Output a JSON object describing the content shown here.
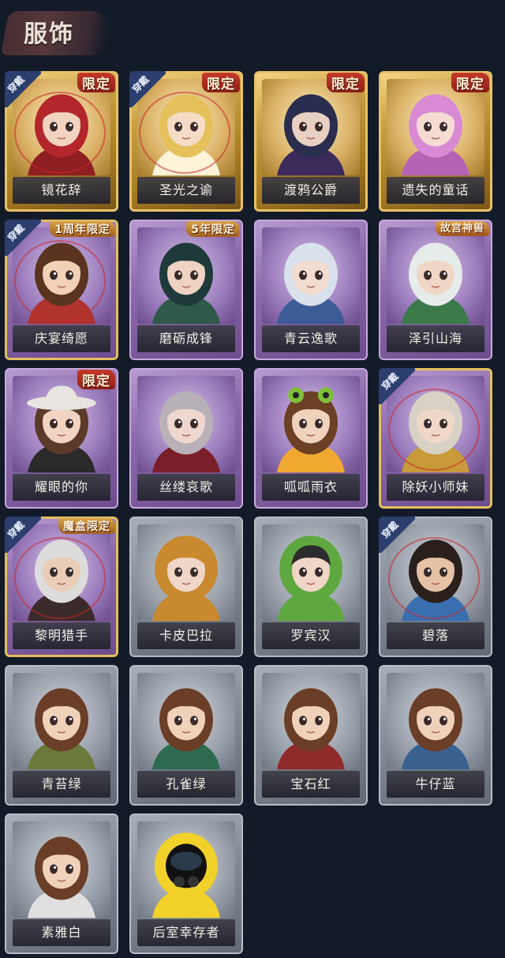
{
  "header": {
    "title": "服饰"
  },
  "badges": {
    "worn": "穿戴"
  },
  "colors": {
    "gold": "#c9a043",
    "purple": "#8c6aaa",
    "gray": "#858c97",
    "background": "#131a28",
    "worn_badge": "#2c3e6e",
    "tag_red": "#c53a2a"
  },
  "costumes": [
    {
      "name": "镜花辞",
      "rarity": "gold",
      "worn": true,
      "tag": "限定",
      "hair": "#b3262b",
      "skin": "#f1d3c0",
      "outfit": "#8e1e22"
    },
    {
      "name": "圣光之谕",
      "rarity": "gold",
      "worn": true,
      "tag": "限定",
      "hair": "#e4c15a",
      "skin": "#f5dcc6",
      "outfit": "#fff3d8"
    },
    {
      "name": "渡鸦公爵",
      "rarity": "gold",
      "worn": false,
      "tag": "限定",
      "hair": "#2a2d4e",
      "skin": "#e8d0c2",
      "outfit": "#3b2a5a"
    },
    {
      "name": "遗失的童话",
      "rarity": "gold",
      "worn": false,
      "tag": "限定",
      "hair": "#d88bd4",
      "skin": "#f6dbd2",
      "outfit": "#b563b5"
    },
    {
      "name": "庆宴绮愿",
      "rarity": "purple",
      "worn": true,
      "tag": "1周年限定",
      "tag_style": "event",
      "gold_edge": true,
      "hair": "#5a3420",
      "skin": "#f2d1b6",
      "outfit": "#b0332e"
    },
    {
      "name": "磨砺成锋",
      "rarity": "purple",
      "worn": false,
      "tag": "5年限定",
      "tag_style": "event",
      "hair": "#1f3a3a",
      "skin": "#eed3c2",
      "outfit": "#2f5a4a"
    },
    {
      "name": "青云逸歌",
      "rarity": "purple",
      "worn": false,
      "hair": "#d9e2ec",
      "skin": "#f2dccf",
      "outfit": "#3d5b94"
    },
    {
      "name": "泽引山海",
      "rarity": "purple",
      "worn": false,
      "tag": "故宫神兽",
      "tag_style": "palace",
      "hair": "#e6ecea",
      "skin": "#f0d6c6",
      "outfit": "#3d7a4a"
    },
    {
      "name": "耀眼的你",
      "rarity": "purple",
      "worn": false,
      "tag": "限定",
      "hair": "#5b3a2a",
      "skin": "#f1d4c2",
      "outfit": "#2a2a2a",
      "hat": "#e8e4e0"
    },
    {
      "name": "丝缕哀歌",
      "rarity": "purple",
      "worn": false,
      "hair": "#b8b1b8",
      "skin": "#efd7d0",
      "outfit": "#7a1f2a"
    },
    {
      "name": "呱呱雨衣",
      "rarity": "purple",
      "worn": false,
      "hair": "#6b4025",
      "skin": "#f0d3bd",
      "outfit": "#f0a830",
      "frog": true
    },
    {
      "name": "除妖小师妹",
      "rarity": "purple",
      "worn": true,
      "gold_edge": true,
      "hair": "#d8d2c6",
      "skin": "#efd8c8",
      "outfit": "#c89a3a"
    },
    {
      "name": "黎明猎手",
      "rarity": "purple",
      "worn": true,
      "tag": "魔盒限定",
      "tag_style": "event",
      "gold_edge": true,
      "hair": "#dcdcdc",
      "skin": "#e9cdb8",
      "outfit": "#3a2a2a"
    },
    {
      "name": "卡皮巴拉",
      "rarity": "gray",
      "worn": false,
      "hair": "#c8892f",
      "skin": "#f0d6c6",
      "outfit": "#c8892f",
      "hood": "#c8892f"
    },
    {
      "name": "罗宾汉",
      "rarity": "gray",
      "worn": false,
      "hair": "#2c2c2c",
      "skin": "#efd6c8",
      "outfit": "#5fa83f",
      "hood": "#5fa83f"
    },
    {
      "name": "碧落",
      "rarity": "gray",
      "worn": true,
      "gold_edge": true,
      "hair": "#2a1f1a",
      "skin": "#e5c2a6",
      "outfit": "#3a6fb0"
    },
    {
      "name": "青苔绿",
      "rarity": "gray",
      "worn": false,
      "hair": "#6b3e28",
      "skin": "#f0d2bb",
      "outfit": "#6a7a3a"
    },
    {
      "name": "孔雀绿",
      "rarity": "gray",
      "worn": false,
      "hair": "#6b3e28",
      "skin": "#f0d2bb",
      "outfit": "#2e6a4f"
    },
    {
      "name": "宝石红",
      "rarity": "gray",
      "worn": false,
      "hair": "#6b3e28",
      "skin": "#f0d2bb",
      "outfit": "#8e2a2a"
    },
    {
      "name": "牛仔蓝",
      "rarity": "gray",
      "worn": false,
      "hair": "#6b3e28",
      "skin": "#f0d2bb",
      "outfit": "#3a6090"
    },
    {
      "name": "素雅白",
      "rarity": "gray",
      "worn": false,
      "hair": "#6b3e28",
      "skin": "#f0d2bb",
      "outfit": "#e0e0e0"
    },
    {
      "name": "后室幸存者",
      "rarity": "gray",
      "worn": false,
      "hair": "#111111",
      "skin": "#111111",
      "outfit": "#f2d22a",
      "hood": "#f2d22a",
      "mask": true
    }
  ]
}
